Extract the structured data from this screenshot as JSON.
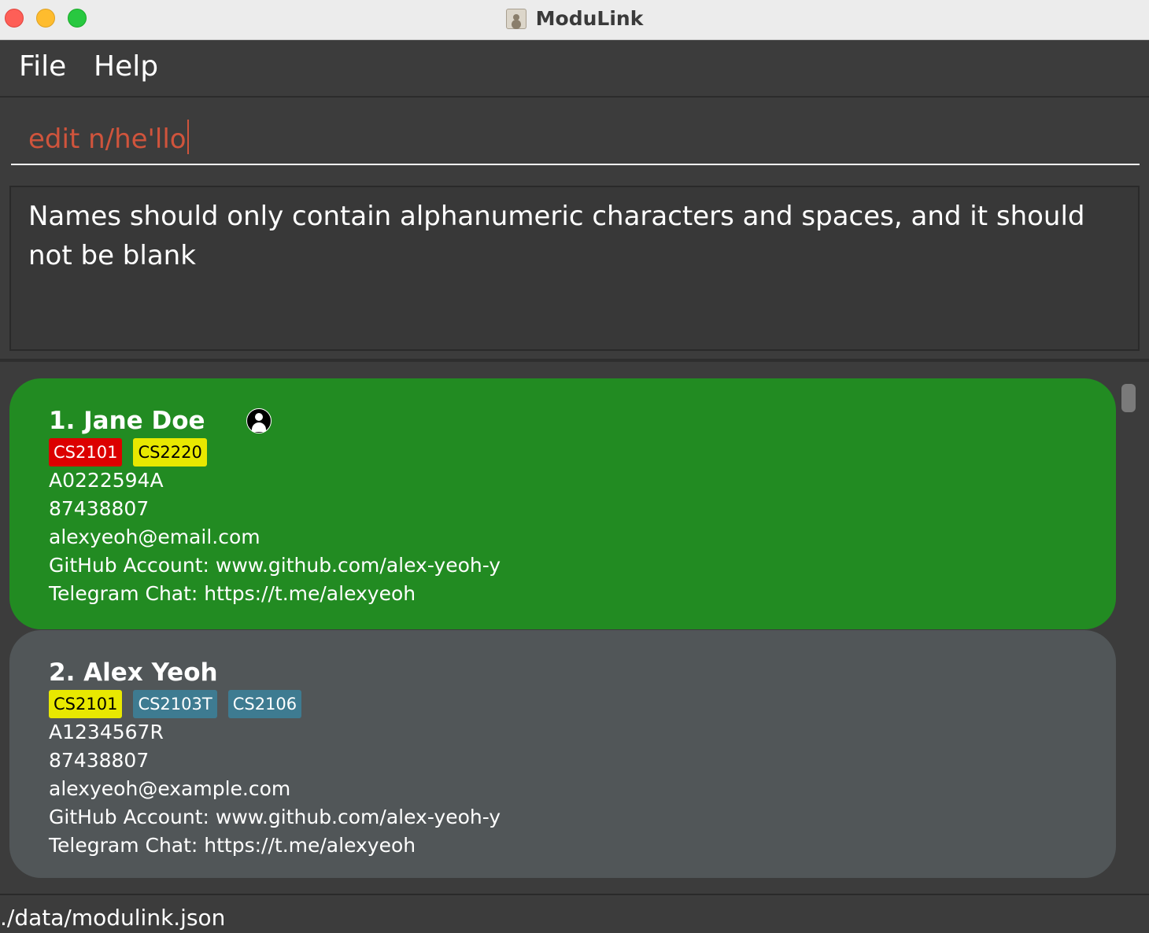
{
  "window": {
    "title": "ModuLink",
    "app_icon": "address-book-icon"
  },
  "menu": {
    "file_label": "File",
    "help_label": "Help"
  },
  "command": {
    "value": "edit n/he'llo"
  },
  "result": {
    "message": "Names should only contain alphanumeric characters and spaces, and it should not be blank"
  },
  "persons": [
    {
      "name": "1. Jane Doe",
      "selected": true,
      "has_avatar": true,
      "tags": [
        {
          "label": "CS2101",
          "color": "#dc0000"
        },
        {
          "label": "CS2220",
          "color": "#e8e800"
        }
      ],
      "student_id": "A0222594A",
      "phone": "87438807",
      "email": "alexyeoh@email.com",
      "github": "GitHub Account: www.github.com/alex-yeoh-y",
      "telegram": "Telegram Chat: https://t.me/alexyeoh"
    },
    {
      "name": "2. Alex Yeoh",
      "selected": false,
      "has_avatar": false,
      "tags": [
        {
          "label": "CS2101",
          "color": "#e8e800"
        },
        {
          "label": "CS2103T",
          "color": "#3e7b91"
        },
        {
          "label": "CS2106",
          "color": "#3e7b91"
        }
      ],
      "student_id": "A1234567R",
      "phone": "87438807",
      "email": "alexyeoh@example.com",
      "github": "GitHub Account: www.github.com/alex-yeoh-y",
      "telegram": "Telegram Chat: https://t.me/alexyeoh"
    }
  ],
  "status": {
    "file_path": "./data/modulink.json"
  },
  "colors": {
    "selected_card": "#228b22",
    "normal_card": "#515658",
    "error_text": "#d0543c"
  }
}
